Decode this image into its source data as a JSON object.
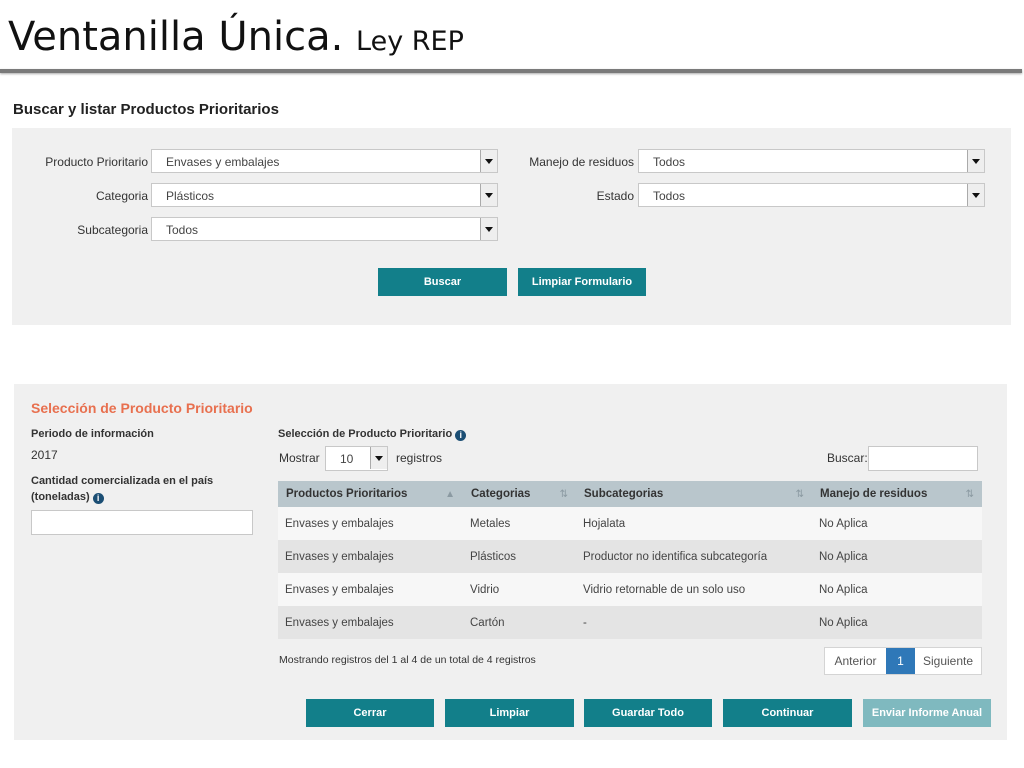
{
  "header": {
    "title_main": "Ventanilla Única.",
    "title_sub": "Ley REP"
  },
  "search": {
    "title": "Buscar y listar Productos Prioritarios",
    "fields": {
      "producto_label": "Producto Prioritario",
      "producto_value": "Envases y embalajes",
      "categoria_label": "Categoria",
      "categoria_value": "Plásticos",
      "subcategoria_label": "Subcategoria",
      "subcategoria_value": "Todos",
      "manejo_label": "Manejo de residuos",
      "manejo_value": "Todos",
      "estado_label": "Estado",
      "estado_value": "Todos"
    },
    "buscar_label": "Buscar",
    "limpiar_label": "Limpiar Formulario"
  },
  "selection": {
    "title": "Selección de Producto Prioritario",
    "periodo_label": "Periodo de información",
    "periodo_value": "2017",
    "cantidad_label_1": "Cantidad comercializada en el país",
    "cantidad_label_2": "(toneladas)",
    "table_title": "Selección de Producto Prioritario",
    "mostrar_label": "Mostrar",
    "mostrar_value": "10",
    "registros_label": "registros",
    "buscar_label": "Buscar:",
    "columns": [
      "Productos Prioritarios",
      "Categorias",
      "Subcategorias",
      "Manejo de residuos"
    ],
    "rows": [
      [
        "Envases y embalajes",
        "Metales",
        "Hojalata",
        "No Aplica"
      ],
      [
        "Envases y embalajes",
        "Plásticos",
        "Productor no identifica subcategoría",
        "No Aplica"
      ],
      [
        "Envases y embalajes",
        "Vidrio",
        "Vidrio retornable de un solo uso",
        "No Aplica"
      ],
      [
        "Envases y embalajes",
        "Cartón",
        "-",
        "No Aplica"
      ]
    ],
    "summary": "Mostrando registros del 1 al 4 de un total de 4 registros",
    "pager": {
      "prev": "Anterior",
      "current": "1",
      "next": "Siguiente"
    }
  },
  "actions": {
    "cerrar": "Cerrar",
    "limpiar": "Limpiar",
    "guardar": "Guardar Todo",
    "continuar": "Continuar",
    "enviar": "Enviar Informe Anual"
  },
  "colors": {
    "accent": "#127f8a",
    "section_title": "#e8704f",
    "table_header": "#b9c6cc",
    "pager_active": "#2f78b8"
  }
}
